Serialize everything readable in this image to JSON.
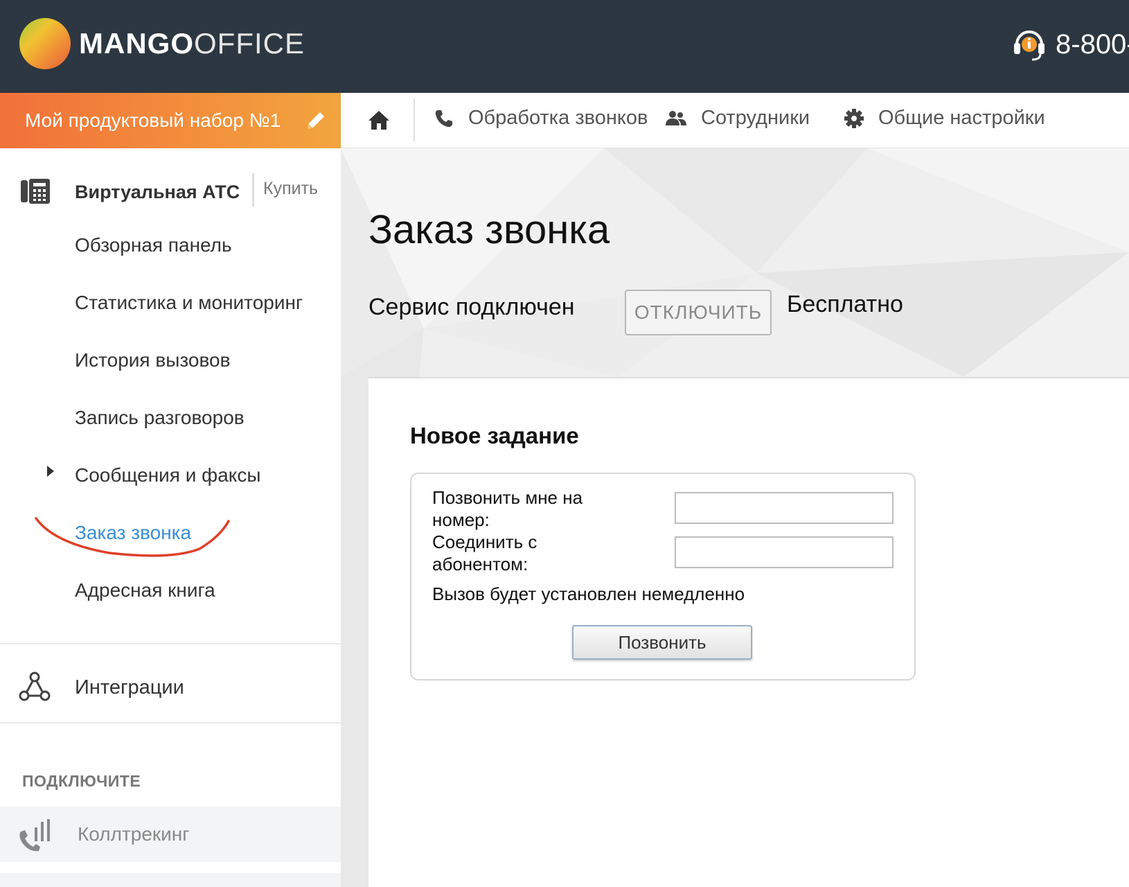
{
  "header": {
    "logo_bold": "MANGO",
    "logo_light": "OFFICE",
    "phone": "8-800-",
    "icons": {
      "logo": "mango-logo",
      "support": "headset-icon"
    }
  },
  "product": {
    "label": "Мой продуктовый набор №1",
    "edit_icon": "pencil-icon"
  },
  "nav": {
    "home_icon": "home-icon",
    "items": [
      {
        "label": "Обработка звонков",
        "icon": "phone-icon"
      },
      {
        "label": "Сотрудники",
        "icon": "users-icon"
      },
      {
        "label": "Общие настройки",
        "icon": "gear-icon"
      }
    ]
  },
  "sidebar": {
    "pbx_title": "Виртуальная АТС",
    "buy_label": "Купить",
    "items": [
      {
        "label": "Обзорная панель"
      },
      {
        "label": "Статистика и мониторинг"
      },
      {
        "label": "История вызовов"
      },
      {
        "label": "Запись разговоров"
      },
      {
        "label": "Сообщения и факсы",
        "expandable": true
      },
      {
        "label": "Заказ звонка",
        "active": true
      },
      {
        "label": "Адресная книга"
      }
    ],
    "integrations_label": "Интеграции",
    "connect_heading": "ПОДКЛЮЧИТЕ",
    "calltracking_label": "Коллтрекинг"
  },
  "page": {
    "title": "Заказ звонка",
    "service_status": "Сервис подключен",
    "disable_button": "ОТКЛЮЧИТЬ",
    "price": "Бесплатно"
  },
  "task": {
    "title": "Новое задание",
    "call_me_label": "Позвонить мне на номер:",
    "call_me_value": "",
    "connect_label": "Соединить с абонентом:",
    "connect_value": "",
    "info": "Вызов будет установлен немедленно",
    "call_button": "Позвонить"
  },
  "colors": {
    "header_bg": "#2d3741",
    "accent_orange": "#f1713a",
    "active_link": "#3a8ed8",
    "annotation_red": "#e0402a"
  }
}
